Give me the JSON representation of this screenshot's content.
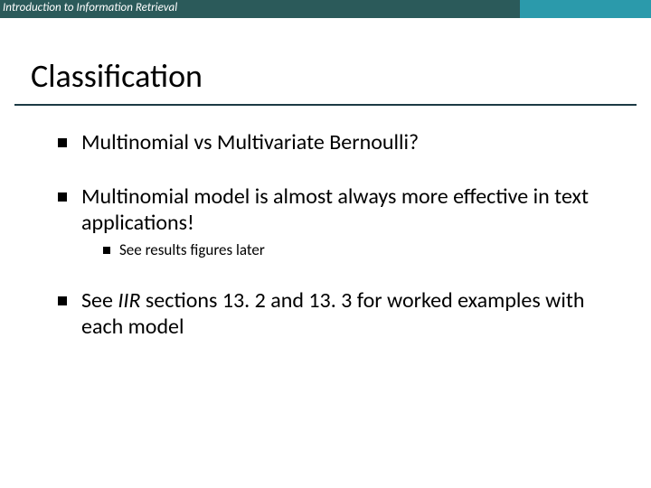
{
  "header": {
    "title": "Introduction to Information Retrieval"
  },
  "title": "Classification",
  "bullets": [
    {
      "text": "Multinomial vs Multivariate Bernoulli?"
    },
    {
      "text": "Multinomial model is almost always more effective in text applications!",
      "sub": [
        {
          "text": "See results figures later"
        }
      ]
    },
    {
      "prefix": "See ",
      "em": "IIR",
      "suffix": " sections 13. 2 and 13. 3 for worked examples with each model"
    }
  ]
}
